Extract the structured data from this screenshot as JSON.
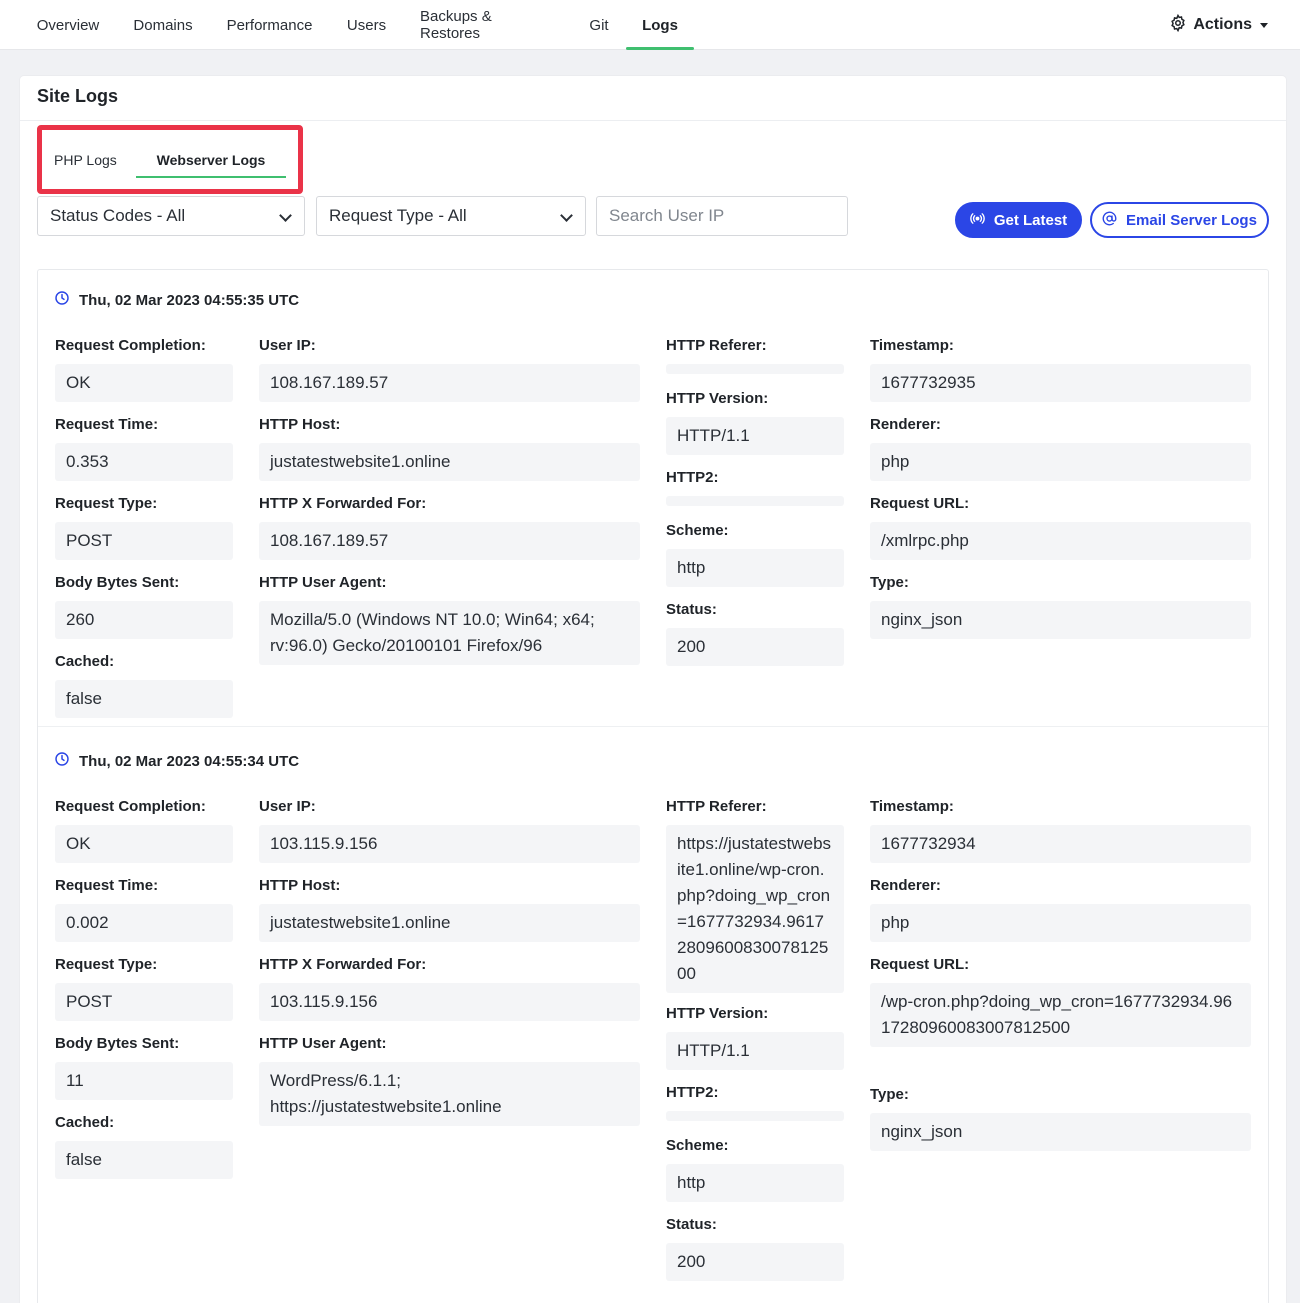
{
  "nav": {
    "tabs": [
      {
        "label": "Overview"
      },
      {
        "label": "Domains"
      },
      {
        "label": "Performance"
      },
      {
        "label": "Users"
      },
      {
        "label": "Backups & Restores"
      },
      {
        "label": "Git"
      },
      {
        "label": "Logs"
      }
    ],
    "active": "Logs",
    "actions_label": "Actions"
  },
  "card": {
    "title": "Site Logs",
    "subtabs": [
      {
        "label": "PHP Logs"
      },
      {
        "label": "Webserver Logs"
      }
    ],
    "active_subtab": "Webserver Logs"
  },
  "filters": {
    "status_codes": "Status Codes - All",
    "request_type": "Request Type - All",
    "search_placeholder": "Search User IP",
    "search_value": ""
  },
  "buttons": {
    "get_latest": "Get Latest",
    "email_logs": "Email Server Logs"
  },
  "colors": {
    "accent_green": "#3fbf6f",
    "primary_blue": "#2b46e6",
    "highlight_red": "#ea3348"
  },
  "labels": {
    "request_completion": "Request Completion:",
    "request_time": "Request Time:",
    "request_type": "Request Type:",
    "body_bytes_sent": "Body Bytes Sent:",
    "cached": "Cached:",
    "user_ip": "User IP:",
    "http_host": "HTTP Host:",
    "http_x_forwarded_for": "HTTP X Forwarded For:",
    "http_user_agent": "HTTP User Agent:",
    "http_referer": "HTTP Referer:",
    "http_version": "HTTP Version:",
    "http2": "HTTP2:",
    "scheme": "Scheme:",
    "status": "Status:",
    "timestamp": "Timestamp:",
    "renderer": "Renderer:",
    "request_url": "Request URL:",
    "type": "Type:"
  },
  "entries": [
    {
      "datetime": "Thu, 02 Mar 2023 04:55:35 UTC",
      "request_completion": "OK",
      "request_time": "0.353",
      "request_type": "POST",
      "body_bytes_sent": "260",
      "cached": "false",
      "user_ip": "108.167.189.57",
      "http_host": "justatestwebsite1.online",
      "http_x_forwarded_for": "108.167.189.57",
      "http_user_agent": "Mozilla/5.0 (Windows NT 10.0; Win64; x64; rv:96.0) Gecko/20100101 Firefox/96",
      "http_referer": "",
      "http_version": "HTTP/1.1",
      "http2": "",
      "scheme": "http",
      "status": "200",
      "timestamp": "1677732935",
      "renderer": "php",
      "request_url": "/xmlrpc.php",
      "type": "nginx_json"
    },
    {
      "datetime": "Thu, 02 Mar 2023 04:55:34 UTC",
      "request_completion": "OK",
      "request_time": "0.002",
      "request_type": "POST",
      "body_bytes_sent": "11",
      "cached": "false",
      "user_ip": "103.115.9.156",
      "http_host": "justatestwebsite1.online",
      "http_x_forwarded_for": "103.115.9.156",
      "http_user_agent": "WordPress/6.1.1; https://justatestwebsite1.online",
      "http_referer": "https://justatestwebsite1.online/wp-cron.php?doing_wp_cron=1677732934.9617280960083007812500",
      "http_version": "HTTP/1.1",
      "http2": "",
      "scheme": "http",
      "status": "200",
      "timestamp": "1677732934",
      "renderer": "php",
      "request_url": "/wp-cron.php?doing_wp_cron=1677732934.9617280960083007812500",
      "type": "nginx_json"
    }
  ]
}
